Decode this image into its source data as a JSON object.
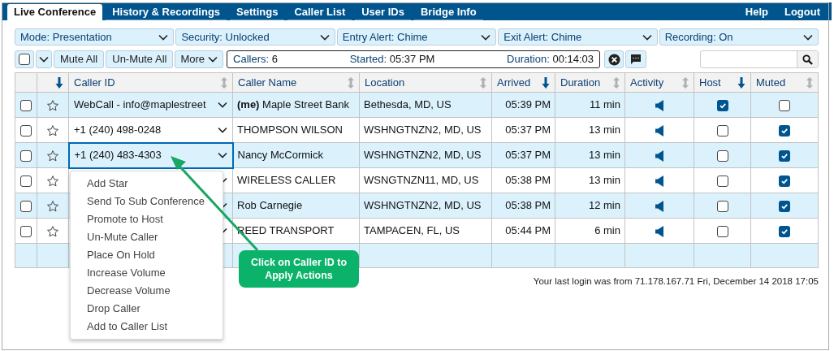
{
  "tabs": [
    {
      "label": "Live Conference",
      "selected": true
    },
    {
      "label": "History & Recordings",
      "selected": false
    },
    {
      "label": "Settings",
      "selected": false
    },
    {
      "label": "Caller List",
      "selected": false
    },
    {
      "label": "User IDs",
      "selected": false
    },
    {
      "label": "Bridge Info",
      "selected": false
    }
  ],
  "top_links": [
    "Help",
    "Logout"
  ],
  "settings": [
    {
      "label": "Mode:",
      "value": "Presentation"
    },
    {
      "label": "Security:",
      "value": "Unlocked"
    },
    {
      "label": "Entry Alert:",
      "value": "Chime"
    },
    {
      "label": "Exit Alert:",
      "value": "Chime"
    },
    {
      "label": "Recording:",
      "value": "On"
    }
  ],
  "toolbar": {
    "select_all_checked": false,
    "buttons": [
      "Mute All",
      "Un-Mute All"
    ],
    "more": "More",
    "callers_label": "Callers:",
    "callers": "6",
    "started_label": "Started:",
    "started": "05:37 PM",
    "duration_label": "Duration:",
    "duration": "00:14:03"
  },
  "table": {
    "columns": [
      {},
      {
        "sorted": true
      },
      {
        "label": "Caller ID",
        "sorted": false
      },
      {
        "label": "Caller Name",
        "sorted": false
      },
      {
        "label": "Location",
        "sorted": false
      },
      {
        "label": "Arrived",
        "sorted": true
      },
      {
        "label": "Duration",
        "sorted": false
      },
      {
        "label": "Activity",
        "sorted": false
      },
      {
        "label": "Host",
        "sorted": true
      },
      {
        "label": "Muted",
        "sorted": false
      }
    ],
    "rows": [
      {
        "checked": false,
        "starred": false,
        "caller_id": "WebCall - info@maplestreet",
        "selected": false,
        "caller_name": "**(me)** Maple Street Bank",
        "location": "Bethesda, MD, US",
        "arrived": "05:39 PM",
        "duration": "11 min",
        "host": true,
        "muted": false
      },
      {
        "checked": false,
        "starred": false,
        "caller_id": "+1 (240) 498-0248",
        "selected": false,
        "caller_name": "THOMPSON WILSON",
        "location": "WSHNGTNZN2, MD, US",
        "arrived": "05:37 PM",
        "duration": "13 min",
        "host": false,
        "muted": true
      },
      {
        "checked": false,
        "starred": false,
        "caller_id": "+1 (240) 483-4303",
        "selected": true,
        "caller_name": "Nancy McCormick",
        "location": "WSHNGTNZN2, MD, US",
        "arrived": "05:37 PM",
        "duration": "13 min",
        "host": false,
        "muted": true
      },
      {
        "checked": false,
        "starred": false,
        "selected": false,
        "caller_name": "WIRELESS CALLER",
        "location": "WSNGTNZN11, MD, US",
        "arrived": "05:38 PM",
        "duration": "13 min",
        "host": false,
        "muted": true
      },
      {
        "checked": false,
        "starred": false,
        "selected": false,
        "caller_name": "Rob Carnegie",
        "location": "WSHNGTNZN2, MD, US",
        "arrived": "05:38 PM",
        "duration": "12 min",
        "host": false,
        "muted": true
      },
      {
        "checked": false,
        "starred": false,
        "selected": false,
        "caller_name": "REED TRANSPORT",
        "location": "TAMPACEN, FL, US",
        "arrived": "05:44 PM",
        "duration": "6 min",
        "host": false,
        "muted": true
      }
    ]
  },
  "actions_menu": [
    "Add Star",
    "Send To Sub Conference",
    "Promote to Host",
    "Un-Mute Caller",
    "Place On Hold",
    "Increase Volume",
    "Decrease Volume",
    "Drop Caller",
    "Add to Caller List"
  ],
  "callout": "Click on Caller ID to Apply Actions",
  "last_login": "Your last login was from 71.178.167.71 Fri, December 14 2018 17:05"
}
